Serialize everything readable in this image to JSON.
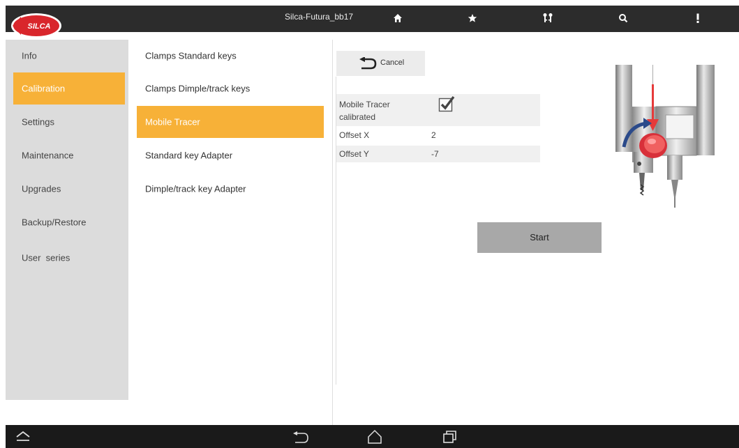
{
  "app": {
    "title": "Silca-Futura_bb17",
    "logo_text": "SILCA",
    "accent_color": "#f7b138"
  },
  "topbar_icons": [
    "home-icon",
    "star-icon",
    "keys-icon",
    "search-icon",
    "more-vertical-icon"
  ],
  "sidebar": {
    "items": [
      {
        "label": "Info",
        "active": false
      },
      {
        "label": "Calibration",
        "active": true
      },
      {
        "label": "Settings",
        "active": false
      },
      {
        "label": "Maintenance",
        "active": false
      },
      {
        "label": "Upgrades",
        "active": false
      },
      {
        "label": "Backup/Restore",
        "active": false
      },
      {
        "label": "User  series",
        "active": false
      }
    ]
  },
  "submenu": {
    "items": [
      {
        "label": "Clamps Standard keys",
        "active": false
      },
      {
        "label": "Clamps Dimple/track keys",
        "active": false
      },
      {
        "label": "Mobile Tracer",
        "active": true
      },
      {
        "label": "Standard key Adapter",
        "active": false
      },
      {
        "label": "Dimple/track key Adapter",
        "active": false
      }
    ]
  },
  "detail": {
    "cancel_label": "Cancel",
    "rows": [
      {
        "label": "Mobile Tracer calibrated",
        "value": "checked"
      },
      {
        "label": "Offset X",
        "value": "2"
      },
      {
        "label": "Offset Y",
        "value": "-7"
      }
    ],
    "start_label": "Start"
  },
  "navbar_icons": [
    "up-chevron-icon",
    "back-icon",
    "home-outline-icon",
    "recent-apps-icon"
  ]
}
